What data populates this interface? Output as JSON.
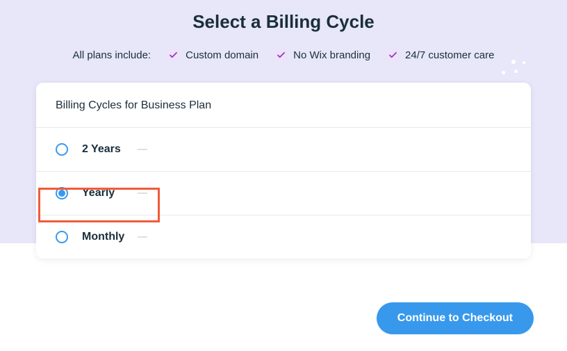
{
  "page": {
    "title": "Select a Billing Cycle"
  },
  "features": {
    "lead": "All plans include:",
    "items": [
      {
        "label": "Custom domain"
      },
      {
        "label": "No Wix branding"
      },
      {
        "label": "24/7 customer care"
      }
    ]
  },
  "card": {
    "header": "Billing Cycles for Business Plan",
    "options": [
      {
        "label": "2 Years",
        "selected": false
      },
      {
        "label": "Yearly",
        "selected": true
      },
      {
        "label": "Monthly",
        "selected": false
      }
    ]
  },
  "actions": {
    "continue": "Continue to Checkout"
  }
}
